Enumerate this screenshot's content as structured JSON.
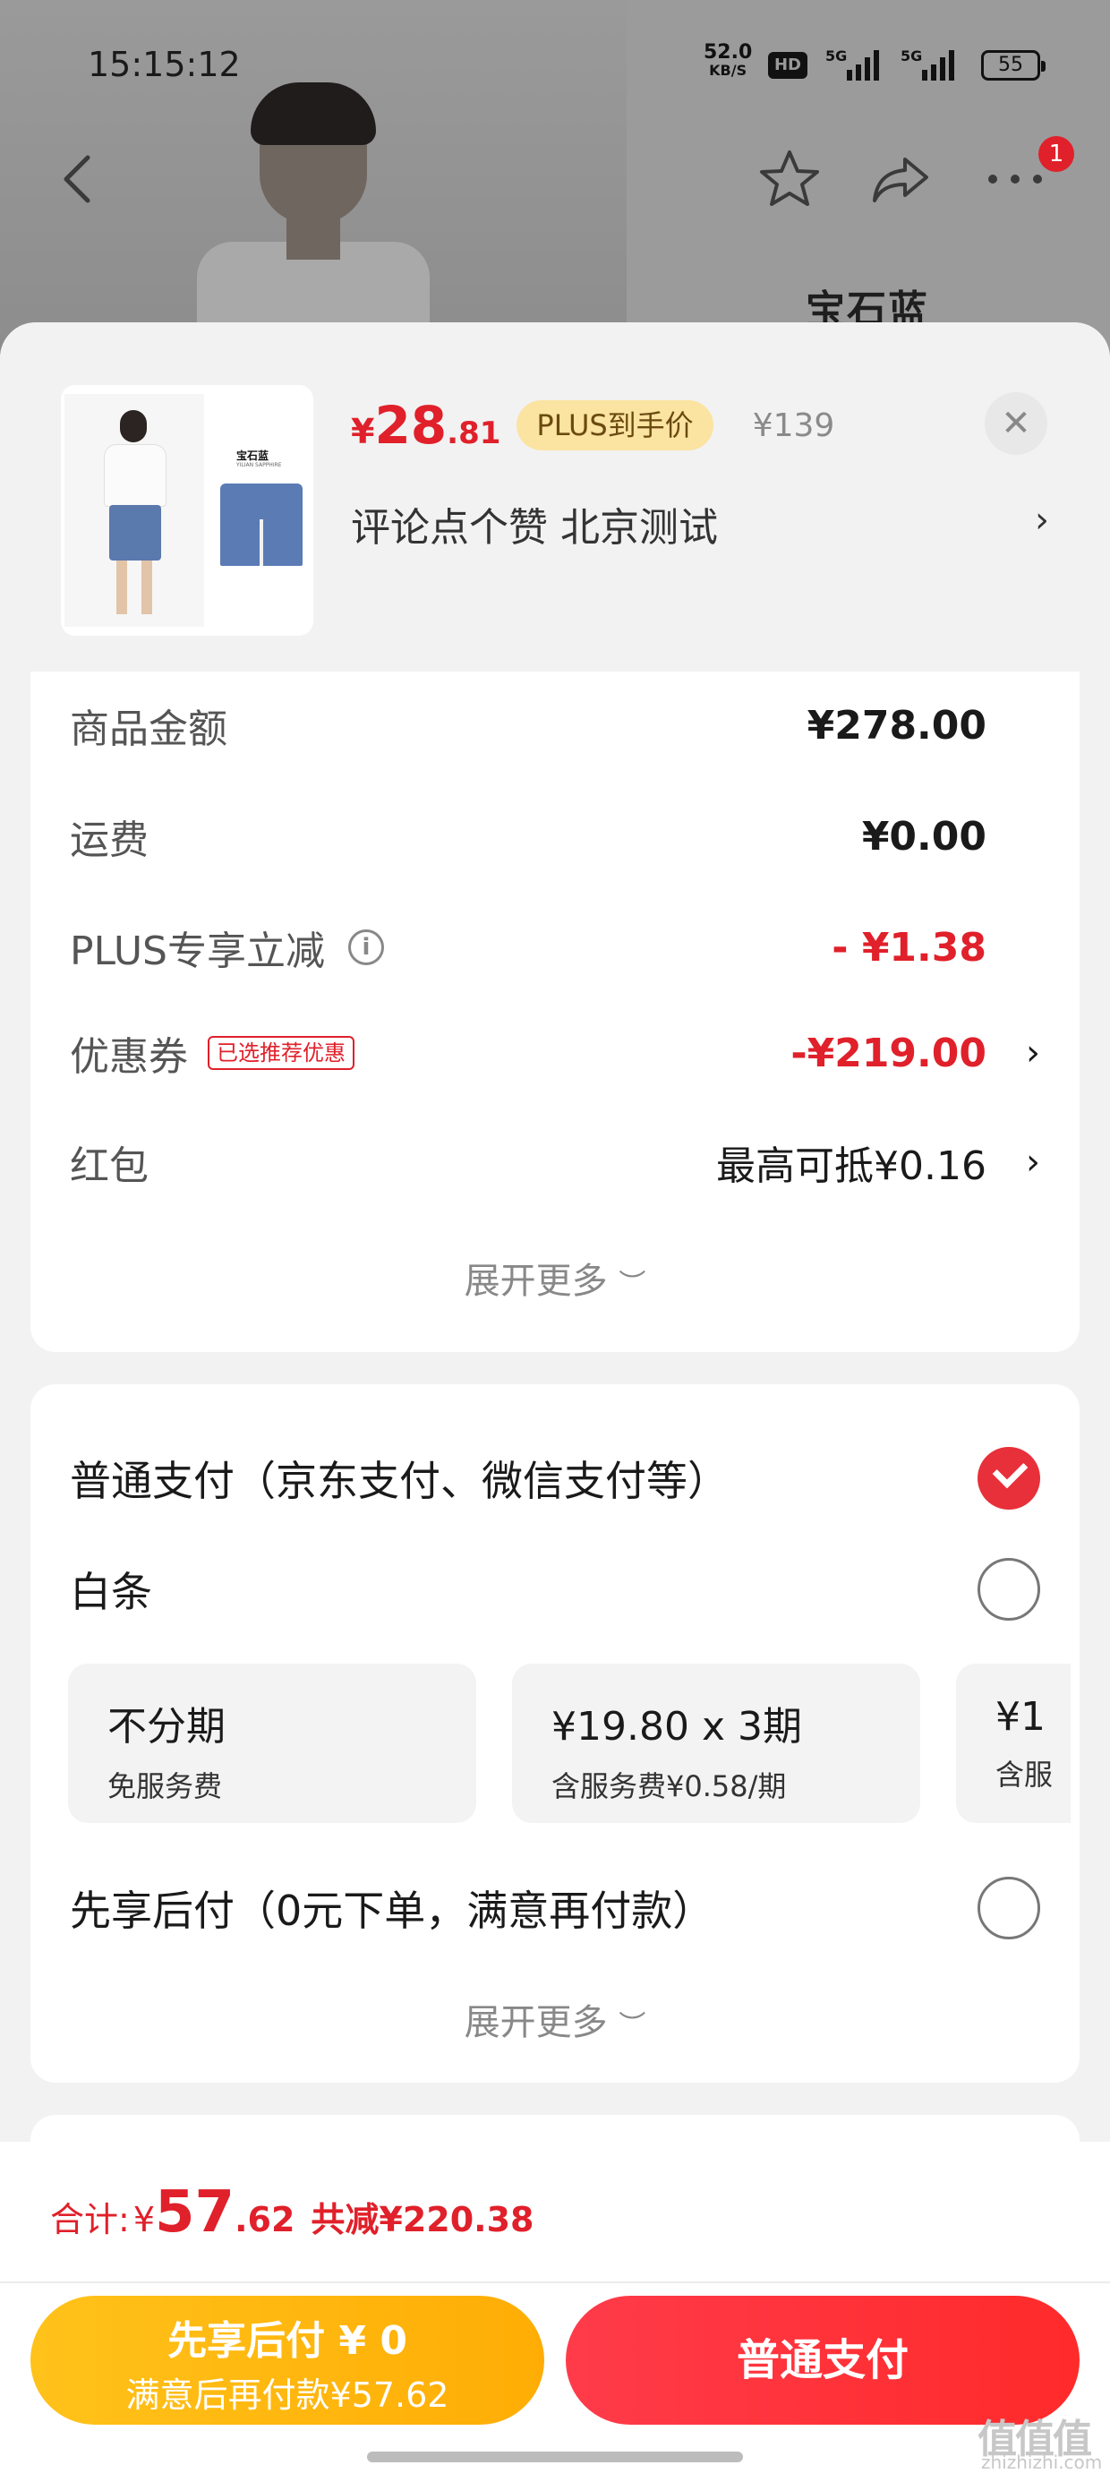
{
  "status_bar": {
    "time": "15:15:12",
    "net_speed": "52.0",
    "net_unit": "KB/S",
    "hd": "HD",
    "signal1": "5G",
    "signal2": "5G",
    "battery": "55"
  },
  "nav": {
    "badge_count": "1"
  },
  "background": {
    "product_color": "宝石蓝"
  },
  "product": {
    "price_symbol": "¥",
    "price_int": "28",
    "price_dec": ".81",
    "plus_badge": "PLUS到手价",
    "original_price": "¥139",
    "address": "评论点个赞  北京测试",
    "thumb_title": "宝石蓝",
    "thumb_subtitle": "YILIAN SAPPHIRE"
  },
  "summary": {
    "rows": [
      {
        "label": "商品金额",
        "value": "¥278.00"
      },
      {
        "label": "运费",
        "value": "¥0.00"
      },
      {
        "label": "PLUS专享立减",
        "value": "- ¥1.38"
      },
      {
        "label": "优惠券",
        "tag": "已选推荐优惠",
        "value": "-¥219.00"
      },
      {
        "label": "红包",
        "value": "最高可抵¥0.16"
      }
    ],
    "expand_more": "展开更多"
  },
  "payment": {
    "options": [
      {
        "label": "普通支付（京东支付、微信支付等）",
        "checked": true
      },
      {
        "label": "白条",
        "checked": false
      },
      {
        "label": "先享后付（0元下单，满意再付款）",
        "checked": false
      }
    ],
    "plans": [
      {
        "title": "不分期",
        "sub": "免服务费"
      },
      {
        "title": "¥19.80 x 3期",
        "sub": "含服务费¥0.58/期"
      },
      {
        "title": "¥1",
        "sub": "含服"
      }
    ],
    "expand_more": "展开更多"
  },
  "footer": {
    "total_label": "合计:",
    "total_symbol": "¥",
    "total_int": "57",
    "total_dec": ".62",
    "total_saved": "共减¥220.38",
    "btn_later_title": "先享后付 ¥ 0",
    "btn_later_sub": "满意后再付款¥57.62",
    "btn_normal": "普通支付",
    "watermark": "值值值",
    "watermark_sub": "zhizhizhi.com"
  },
  "colors": {
    "accent_red": "#e0202a",
    "plus_gold": "#fbe3a1",
    "later_button": "#ffb30d",
    "normal_button": "#ff3340"
  }
}
